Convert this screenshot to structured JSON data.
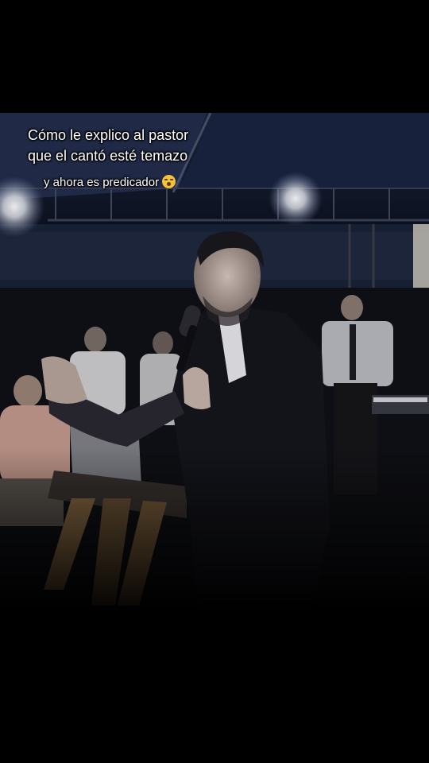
{
  "video": {
    "scene": "concert-stage-photo"
  },
  "caption": {
    "line1": "Cómo le explico al pastor",
    "line2": "que el cantó esté temazo",
    "line3": "y ahora es predicador",
    "emoji": "astonished-face-icon"
  }
}
